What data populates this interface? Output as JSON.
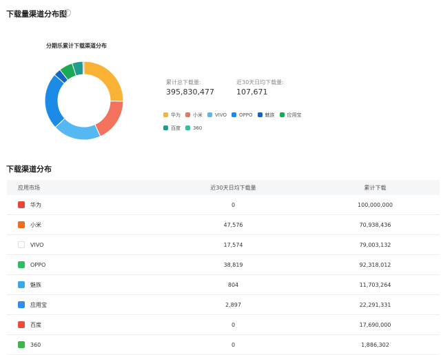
{
  "section1": {
    "title": "下载量渠道分布图",
    "help_icon": "help-circle-icon"
  },
  "chart": {
    "title": "分期乐累计下载渠道分布"
  },
  "stats": {
    "total_label": "累计总下载量:",
    "total_value": "395,830,477",
    "avg_label": "近30天日均下载量:",
    "avg_value": "107,671"
  },
  "section2": {
    "title": "下载渠道分布"
  },
  "table": {
    "headers": [
      "应用市场",
      "近30天日均下载量",
      "累计下载"
    ],
    "rows": [
      {
        "name": "华为",
        "daily": "0",
        "total": "100,000,000",
        "icon": "huawei-icon",
        "color": "#e8463a"
      },
      {
        "name": "小米",
        "daily": "47,576",
        "total": "70,938,436",
        "icon": "xiaomi-icon",
        "color": "#f06c22"
      },
      {
        "name": "VIVO",
        "daily": "17,574",
        "total": "79,003,132",
        "icon": "vivo-icon",
        "color": "#ffffff"
      },
      {
        "name": "OPPO",
        "daily": "38,819",
        "total": "92,318,012",
        "icon": "oppo-icon",
        "color": "#2dbf68"
      },
      {
        "name": "魅族",
        "daily": "804",
        "total": "11,703,264",
        "icon": "meizu-icon",
        "color": "#3aa7e8"
      },
      {
        "name": "应用宝",
        "daily": "2,897",
        "total": "22,291,331",
        "icon": "yingyongbao-icon",
        "color": "#2f8ef0"
      },
      {
        "name": "百度",
        "daily": "0",
        "total": "17,690,000",
        "icon": "baidu-icon",
        "color": "#e94b3c"
      },
      {
        "name": "360",
        "daily": "0",
        "total": "1,886,302",
        "icon": "360-icon",
        "color": "#3cb54a"
      }
    ]
  },
  "chart_data": {
    "type": "pie",
    "title": "分期乐累计下载渠道分布",
    "categories": [
      "华为",
      "小米",
      "VIVO",
      "OPPO",
      "魅族",
      "应用宝",
      "百度",
      "360"
    ],
    "values": [
      100000000,
      70938436,
      79003132,
      92318012,
      11703264,
      22291331,
      17690000,
      1886302
    ],
    "colors": [
      "#f9b233",
      "#f2725b",
      "#55b8f2",
      "#1c8be6",
      "#1565c0",
      "#1aaa55",
      "#1e9e8a",
      "#2cc3a0"
    ],
    "legend_position": "right"
  }
}
